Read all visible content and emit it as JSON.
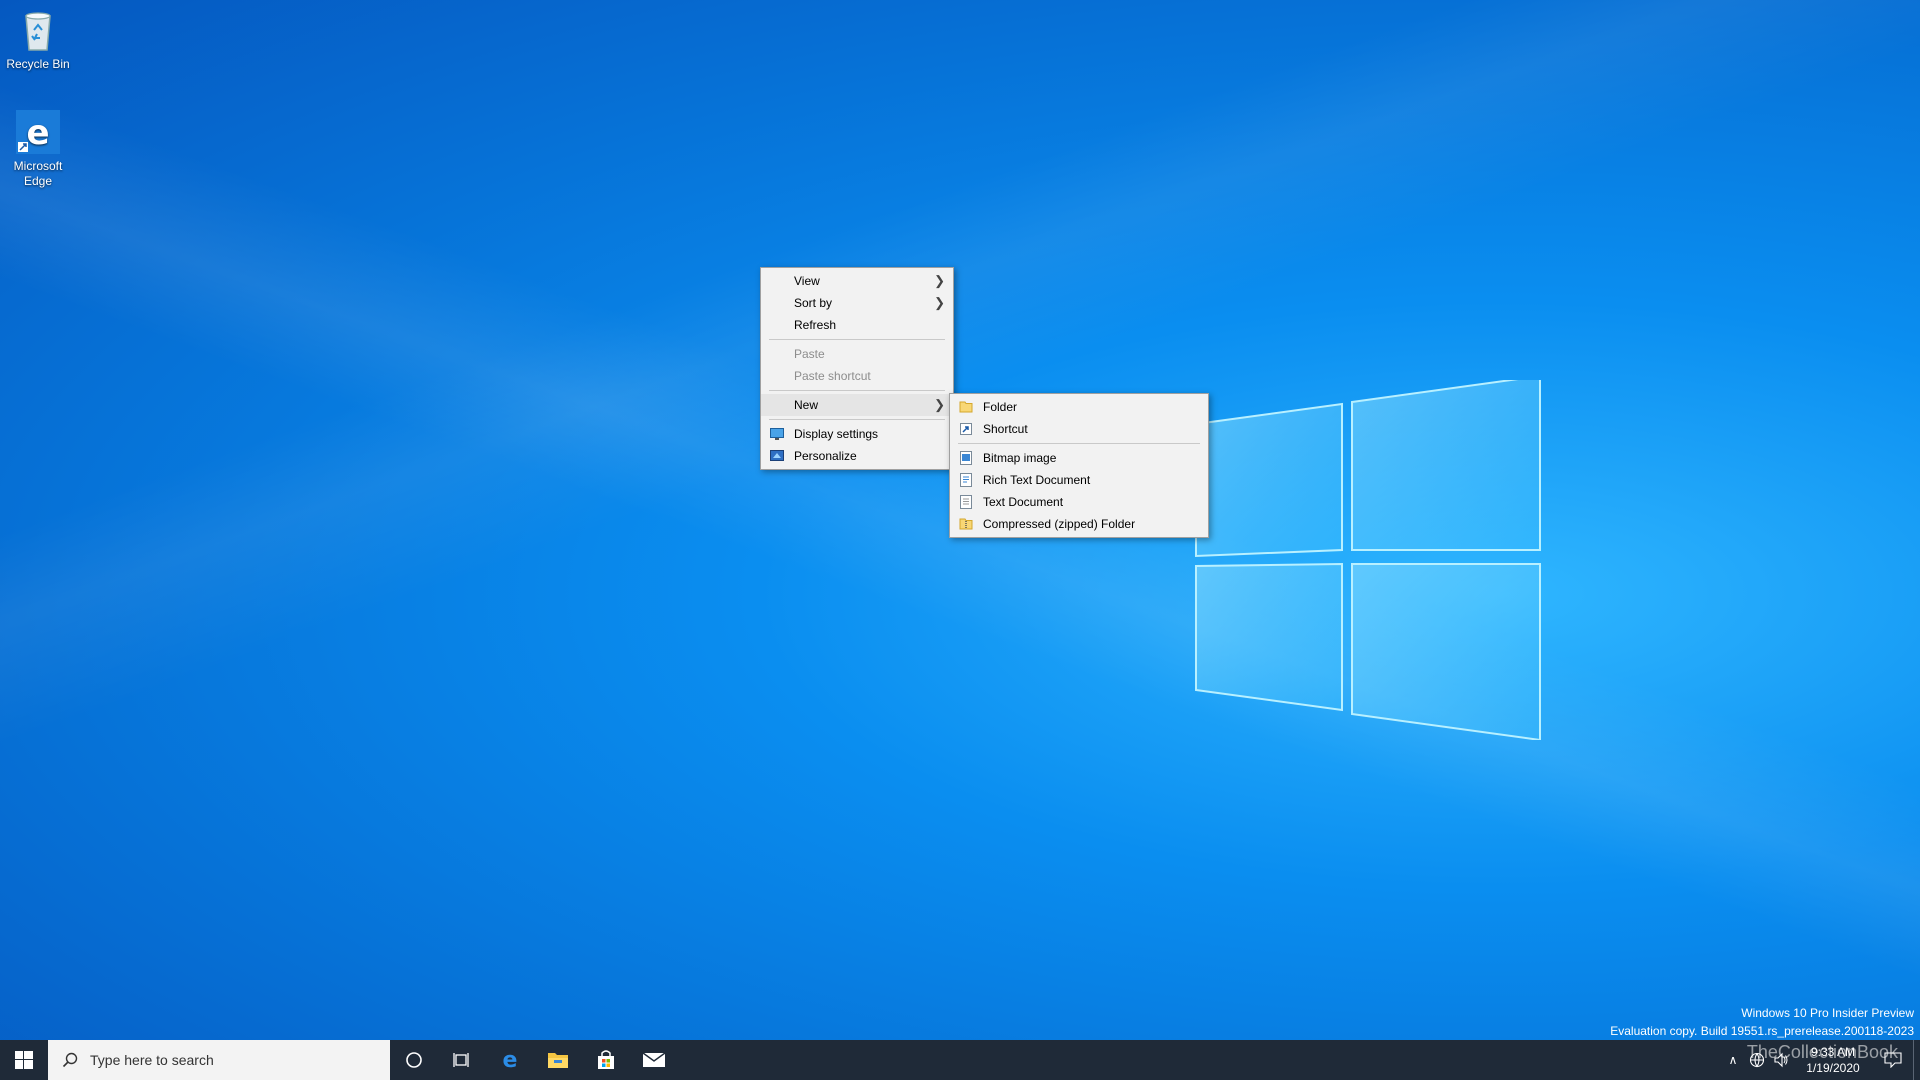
{
  "desktop": {
    "icons": [
      {
        "label": "Recycle Bin",
        "icon": "recycle-bin-icon"
      },
      {
        "label": "Microsoft Edge",
        "icon": "edge-icon"
      }
    ]
  },
  "context_menu": {
    "items": [
      {
        "label": "View",
        "submenu": true
      },
      {
        "label": "Sort by",
        "submenu": true
      },
      {
        "label": "Refresh"
      },
      {
        "label": "Paste",
        "disabled": true
      },
      {
        "label": "Paste shortcut",
        "disabled": true
      },
      {
        "label": "New",
        "submenu": true,
        "highlighted": true
      },
      {
        "label": "Display settings",
        "icon": "display-settings-icon"
      },
      {
        "label": "Personalize",
        "icon": "personalize-icon"
      }
    ]
  },
  "new_submenu": {
    "items": [
      {
        "label": "Folder",
        "icon": "folder-icon"
      },
      {
        "label": "Shortcut",
        "icon": "shortcut-icon"
      },
      {
        "label": "Bitmap image",
        "icon": "bitmap-icon"
      },
      {
        "label": "Rich Text Document",
        "icon": "rich-text-icon"
      },
      {
        "label": "Text Document",
        "icon": "text-document-icon"
      },
      {
        "label": "Compressed (zipped) Folder",
        "icon": "zip-folder-icon"
      }
    ]
  },
  "taskbar": {
    "search_placeholder": "Type here to search",
    "time": "9:33 AM",
    "date": "1/19/2020"
  },
  "watermark": {
    "line1": "Windows 10 Pro Insider Preview",
    "line2": "Evaluation copy. Build 19551.rs_prerelease.200118-2023",
    "site": "TheCollectionBook"
  },
  "colors": {
    "taskbar": "#1f2a38",
    "menu_bg": "#f2f2f2",
    "accent": "#0078d7"
  }
}
